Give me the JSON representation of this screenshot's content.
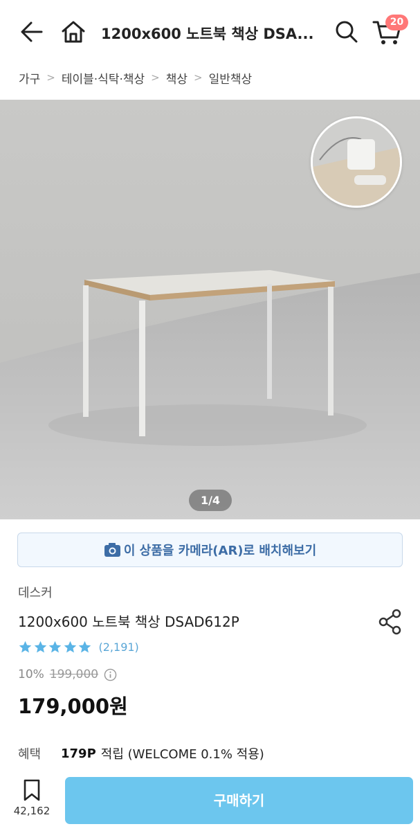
{
  "header": {
    "title": "1200x600 노트북 책상 DSA...",
    "cart_count": "20",
    "icons": {
      "back": "arrow-left-icon",
      "home": "home-icon",
      "search": "search-icon",
      "cart": "cart-icon"
    }
  },
  "breadcrumb": {
    "items": [
      "가구",
      "테이블·식탁·책상",
      "책상",
      "일반책상"
    ]
  },
  "gallery": {
    "page_indicator": "1/4"
  },
  "ar_button": {
    "label": "이 상품을 카메라(AR)로 배치해보기",
    "icon": "camera-icon",
    "color": "#3d6da6"
  },
  "product": {
    "brand": "데스커",
    "name": "1200x600 노트북 책상 DSAD612P",
    "rating": 5,
    "review_count": "(2,191)",
    "discount_rate": "10%",
    "original_price": "199,000",
    "price": "179,000원"
  },
  "benefit": {
    "label": "혜택",
    "points": "179P",
    "text": "적립 (WELCOME 0.1% 적용)"
  },
  "bottom_bar": {
    "bookmark_count": "42,162",
    "buy_label": "구매하기",
    "buy_color": "#6cc6ee"
  }
}
